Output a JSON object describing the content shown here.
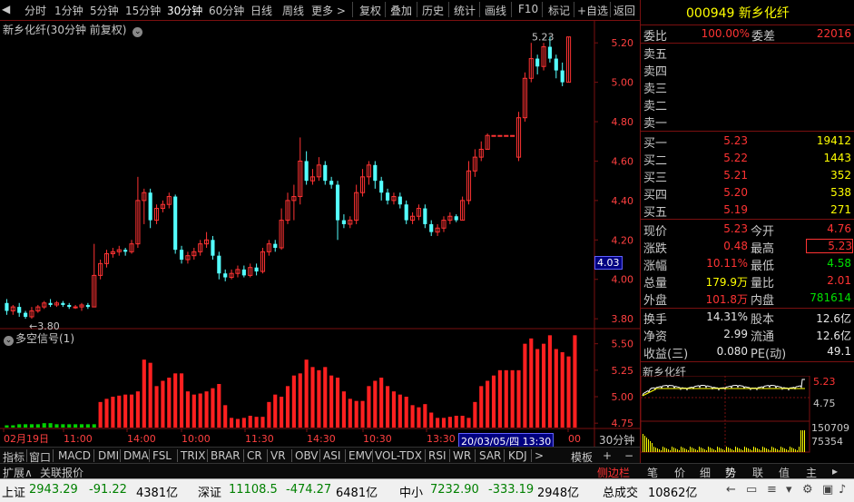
{
  "toolbar": {
    "period_tabs": [
      "分时",
      "1分钟",
      "5分钟",
      "15分钟",
      "30分钟",
      "60分钟",
      "日线",
      "周线",
      "更多 >"
    ],
    "active_period": "30分钟",
    "actions": [
      "复权",
      "叠加",
      "历史",
      "统计",
      "画线",
      "F10",
      "标记",
      "+自选",
      "返回"
    ]
  },
  "chart_title": "新乡化纤(30分钟 前复权)",
  "indicator_title": "多空信号(1)",
  "price_axis": [
    "5.20",
    "5.00",
    "4.80",
    "4.60",
    "4.40",
    "4.20",
    "4.00",
    "3.80"
  ],
  "indicator_axis": [
    "5.50",
    "5.25",
    "5.00",
    "4.75"
  ],
  "cursor_price": "4.03",
  "high_marker": "5.23",
  "low_marker": "3.80",
  "time_axis": [
    "02月19日",
    "11:00",
    "14:00",
    "10:00",
    "11:30",
    "14:30",
    "10:30",
    "13:30",
    "20/03/05/四 13:30",
    "00"
  ],
  "period_box": "30分钟",
  "chart_data": {
    "type": "candlestick",
    "x": [
      "02月19日",
      "11:00",
      "14:00",
      "10:00",
      "11:30",
      "14:30",
      "10:30",
      "13:30",
      "20/03/05/四 13:30"
    ],
    "ylim": [
      3.75,
      5.27
    ],
    "candles": [
      {
        "o": 3.88,
        "c": 3.84,
        "h": 3.9,
        "l": 3.82
      },
      {
        "o": 3.84,
        "c": 3.86,
        "h": 3.87,
        "l": 3.82
      },
      {
        "o": 3.86,
        "c": 3.83,
        "h": 3.88,
        "l": 3.81
      },
      {
        "o": 3.83,
        "c": 3.81,
        "h": 3.84,
        "l": 3.8
      },
      {
        "o": 3.81,
        "c": 3.84,
        "h": 3.86,
        "l": 3.8
      },
      {
        "o": 3.84,
        "c": 3.86,
        "h": 3.87,
        "l": 3.83
      },
      {
        "o": 3.86,
        "c": 3.88,
        "h": 3.89,
        "l": 3.85
      },
      {
        "o": 3.88,
        "c": 3.87,
        "h": 3.9,
        "l": 3.86
      },
      {
        "o": 3.87,
        "c": 3.88,
        "h": 3.89,
        "l": 3.86
      },
      {
        "o": 3.88,
        "c": 3.87,
        "h": 3.89,
        "l": 3.86
      },
      {
        "o": 3.87,
        "c": 3.86,
        "h": 3.88,
        "l": 3.85
      },
      {
        "o": 3.86,
        "c": 3.86,
        "h": 3.87,
        "l": 3.85
      },
      {
        "o": 3.86,
        "c": 3.87,
        "h": 3.88,
        "l": 3.84
      },
      {
        "o": 3.87,
        "c": 3.86,
        "h": 3.88,
        "l": 3.85
      },
      {
        "o": 3.86,
        "c": 4.02,
        "h": 4.18,
        "l": 3.86
      },
      {
        "o": 4.02,
        "c": 4.08,
        "h": 4.1,
        "l": 4.0
      },
      {
        "o": 4.08,
        "c": 4.13,
        "h": 4.15,
        "l": 4.06
      },
      {
        "o": 4.13,
        "c": 4.14,
        "h": 4.16,
        "l": 4.11
      },
      {
        "o": 4.14,
        "c": 4.15,
        "h": 4.17,
        "l": 4.12
      },
      {
        "o": 4.15,
        "c": 4.14,
        "h": 4.16,
        "l": 4.12
      },
      {
        "o": 4.14,
        "c": 4.18,
        "h": 4.2,
        "l": 4.13
      },
      {
        "o": 4.18,
        "c": 4.4,
        "h": 4.52,
        "l": 4.16
      },
      {
        "o": 4.4,
        "c": 4.44,
        "h": 4.46,
        "l": 4.28
      },
      {
        "o": 4.44,
        "c": 4.3,
        "h": 4.46,
        "l": 4.26
      },
      {
        "o": 4.3,
        "c": 4.36,
        "h": 4.38,
        "l": 4.28
      },
      {
        "o": 4.36,
        "c": 4.38,
        "h": 4.4,
        "l": 4.34
      },
      {
        "o": 4.38,
        "c": 4.42,
        "h": 4.44,
        "l": 4.36
      },
      {
        "o": 4.42,
        "c": 4.15,
        "h": 4.43,
        "l": 4.13
      },
      {
        "o": 4.15,
        "c": 4.1,
        "h": 4.17,
        "l": 4.08
      },
      {
        "o": 4.1,
        "c": 4.12,
        "h": 4.14,
        "l": 4.08
      },
      {
        "o": 4.12,
        "c": 4.14,
        "h": 4.16,
        "l": 4.1
      },
      {
        "o": 4.14,
        "c": 4.18,
        "h": 4.2,
        "l": 4.12
      },
      {
        "o": 4.18,
        "c": 4.2,
        "h": 4.24,
        "l": 4.16
      },
      {
        "o": 4.2,
        "c": 4.12,
        "h": 4.22,
        "l": 4.1
      },
      {
        "o": 4.12,
        "c": 4.03,
        "h": 4.14,
        "l": 4.0
      },
      {
        "o": 4.03,
        "c": 4.01,
        "h": 4.05,
        "l": 3.99
      },
      {
        "o": 4.01,
        "c": 4.03,
        "h": 4.05,
        "l": 4.0
      },
      {
        "o": 4.03,
        "c": 4.05,
        "h": 4.07,
        "l": 4.01
      },
      {
        "o": 4.05,
        "c": 4.02,
        "h": 4.07,
        "l": 4.01
      },
      {
        "o": 4.02,
        "c": 4.06,
        "h": 4.08,
        "l": 4.01
      },
      {
        "o": 4.06,
        "c": 4.04,
        "h": 4.08,
        "l": 4.02
      },
      {
        "o": 4.04,
        "c": 4.14,
        "h": 4.16,
        "l": 4.03
      },
      {
        "o": 4.14,
        "c": 4.18,
        "h": 4.2,
        "l": 4.12
      },
      {
        "o": 4.18,
        "c": 4.16,
        "h": 4.2,
        "l": 4.14
      },
      {
        "o": 4.16,
        "c": 4.3,
        "h": 4.36,
        "l": 4.15
      },
      {
        "o": 4.3,
        "c": 4.4,
        "h": 4.44,
        "l": 4.28
      },
      {
        "o": 4.4,
        "c": 4.42,
        "h": 4.48,
        "l": 4.3
      },
      {
        "o": 4.42,
        "c": 4.6,
        "h": 4.72,
        "l": 4.38
      },
      {
        "o": 4.6,
        "c": 4.5,
        "h": 4.65,
        "l": 4.48
      },
      {
        "o": 4.5,
        "c": 4.52,
        "h": 4.56,
        "l": 4.48
      },
      {
        "o": 4.52,
        "c": 4.58,
        "h": 4.62,
        "l": 4.5
      },
      {
        "o": 4.58,
        "c": 4.5,
        "h": 4.6,
        "l": 4.48
      },
      {
        "o": 4.5,
        "c": 4.48,
        "h": 4.52,
        "l": 4.46
      },
      {
        "o": 4.48,
        "c": 4.3,
        "h": 4.5,
        "l": 4.2
      },
      {
        "o": 4.3,
        "c": 4.28,
        "h": 4.33,
        "l": 4.26
      },
      {
        "o": 4.28,
        "c": 4.3,
        "h": 4.32,
        "l": 4.26
      },
      {
        "o": 4.3,
        "c": 4.44,
        "h": 4.48,
        "l": 4.28
      },
      {
        "o": 4.44,
        "c": 4.52,
        "h": 4.56,
        "l": 4.42
      },
      {
        "o": 4.52,
        "c": 4.58,
        "h": 4.6,
        "l": 4.48
      },
      {
        "o": 4.58,
        "c": 4.5,
        "h": 4.6,
        "l": 4.46
      },
      {
        "o": 4.5,
        "c": 4.44,
        "h": 4.52,
        "l": 4.4
      },
      {
        "o": 4.44,
        "c": 4.4,
        "h": 4.46,
        "l": 4.38
      },
      {
        "o": 4.4,
        "c": 4.42,
        "h": 4.44,
        "l": 4.38
      },
      {
        "o": 4.42,
        "c": 4.38,
        "h": 4.44,
        "l": 4.36
      },
      {
        "o": 4.38,
        "c": 4.3,
        "h": 4.4,
        "l": 4.28
      },
      {
        "o": 4.3,
        "c": 4.32,
        "h": 4.34,
        "l": 4.28
      },
      {
        "o": 4.32,
        "c": 4.36,
        "h": 4.38,
        "l": 4.3
      },
      {
        "o": 4.36,
        "c": 4.28,
        "h": 4.38,
        "l": 4.26
      },
      {
        "o": 4.28,
        "c": 4.24,
        "h": 4.3,
        "l": 4.22
      },
      {
        "o": 4.24,
        "c": 4.26,
        "h": 4.28,
        "l": 4.22
      },
      {
        "o": 4.26,
        "c": 4.3,
        "h": 4.32,
        "l": 4.24
      },
      {
        "o": 4.3,
        "c": 4.32,
        "h": 4.34,
        "l": 4.28
      },
      {
        "o": 4.32,
        "c": 4.3,
        "h": 4.33,
        "l": 4.29
      },
      {
        "o": 4.3,
        "c": 4.4,
        "h": 4.42,
        "l": 4.3
      },
      {
        "o": 4.4,
        "c": 4.55,
        "h": 4.6,
        "l": 4.38
      },
      {
        "o": 4.55,
        "c": 4.62,
        "h": 4.66,
        "l": 4.52
      },
      {
        "o": 4.62,
        "c": 4.66,
        "h": 4.7,
        "l": 4.6
      },
      {
        "o": 4.66,
        "c": 4.73,
        "h": 4.74,
        "l": 4.66
      },
      {
        "o": 4.73,
        "c": 4.73,
        "h": 4.73,
        "l": 4.73
      },
      {
        "o": 4.73,
        "c": 4.73,
        "h": 4.73,
        "l": 4.73
      },
      {
        "o": 4.73,
        "c": 4.73,
        "h": 4.73,
        "l": 4.73
      },
      {
        "o": 4.73,
        "c": 4.73,
        "h": 4.73,
        "l": 4.73
      },
      {
        "o": 4.62,
        "c": 4.82,
        "h": 4.85,
        "l": 4.6
      },
      {
        "o": 4.82,
        "c": 5.02,
        "h": 5.05,
        "l": 4.8
      },
      {
        "o": 5.02,
        "c": 5.12,
        "h": 5.2,
        "l": 5.0
      },
      {
        "o": 5.12,
        "c": 5.08,
        "h": 5.14,
        "l": 5.04
      },
      {
        "o": 5.08,
        "c": 5.18,
        "h": 5.2,
        "l": 5.06
      },
      {
        "o": 5.18,
        "c": 5.12,
        "h": 5.23,
        "l": 5.1
      },
      {
        "o": 5.12,
        "c": 5.06,
        "h": 5.14,
        "l": 5.02
      },
      {
        "o": 5.06,
        "c": 5.0,
        "h": 5.1,
        "l": 4.98
      },
      {
        "o": 5.0,
        "c": 5.23,
        "h": 5.23,
        "l": 5.0
      }
    ],
    "indicator": {
      "name": "多空信号(1)",
      "ylim": [
        4.7,
        5.6
      ],
      "values": [
        4.73,
        4.73,
        4.74,
        4.74,
        4.74,
        4.74,
        4.75,
        4.75,
        4.74,
        4.74,
        4.74,
        4.74,
        4.74,
        4.74,
        4.74,
        4.95,
        4.98,
        5.0,
        5.01,
        5.02,
        5.02,
        5.05,
        5.35,
        5.32,
        5.1,
        5.15,
        5.18,
        5.22,
        5.22,
        5.05,
        5.02,
        5.03,
        5.05,
        5.08,
        5.12,
        4.92,
        4.8,
        4.79,
        4.8,
        4.82,
        4.81,
        4.81,
        4.95,
        5.02,
        5.0,
        5.1,
        5.2,
        5.22,
        5.35,
        5.28,
        5.25,
        5.28,
        5.2,
        5.18,
        5.05,
        4.98,
        4.96,
        4.96,
        5.1,
        5.15,
        5.18,
        5.1,
        5.05,
        5.02,
        5.0,
        4.92,
        4.9,
        4.93,
        4.85,
        4.8,
        4.8,
        4.81,
        4.82,
        4.82,
        4.8,
        4.95,
        5.1,
        5.15,
        5.2,
        5.25,
        5.25,
        5.25,
        5.25,
        5.5,
        5.55,
        5.45,
        5.5,
        5.58,
        5.45,
        5.42,
        5.38,
        5.58
      ]
    }
  },
  "quote": {
    "code": "000949",
    "name": "新乡化纤",
    "webi_label": "委比",
    "webi_value": "100.00%",
    "weicha_label": "委差",
    "weicha_value": "22016",
    "sell_labels": [
      "卖五",
      "卖四",
      "卖三",
      "卖二",
      "卖一"
    ],
    "buy": [
      {
        "label": "买一",
        "price": "5.23",
        "vol": "19412"
      },
      {
        "label": "买二",
        "price": "5.22",
        "vol": "1443"
      },
      {
        "label": "买三",
        "price": "5.21",
        "vol": "352"
      },
      {
        "label": "买四",
        "price": "5.20",
        "vol": "538"
      },
      {
        "label": "买五",
        "price": "5.19",
        "vol": "271"
      }
    ],
    "stats": [
      {
        "l1": "现价",
        "v1": "5.23",
        "c1": "red",
        "l2": "今开",
        "v2": "4.76",
        "c2": "red"
      },
      {
        "l1": "涨跌",
        "v1": "0.48",
        "c1": "red",
        "l2": "最高",
        "v2": "5.23",
        "c2": "red"
      },
      {
        "l1": "涨幅",
        "v1": "10.11%",
        "c1": "red",
        "l2": "最低",
        "v2": "4.58",
        "c2": "green"
      },
      {
        "l1": "总量",
        "v1": "179.9万",
        "c1": "yellow",
        "l2": "量比",
        "v2": "2.01",
        "c2": "red"
      },
      {
        "l1": "外盘",
        "v1": "101.8万",
        "c1": "red",
        "l2": "内盘",
        "v2": "781614",
        "c2": "green"
      }
    ],
    "stats2": [
      {
        "l1": "换手",
        "v1": "14.31%",
        "l2": "股本",
        "v2": "12.6亿"
      },
      {
        "l1": "净资",
        "v1": "2.99",
        "l2": "流通",
        "v2": "12.6亿"
      },
      {
        "l1": "收益(三)",
        "v1": "0.080",
        "l2": "PE(动)",
        "v2": "49.1"
      }
    ]
  },
  "mini": {
    "name": "新乡化纤",
    "price_hi": "5.23",
    "price_lo": "4.75",
    "vol_hi": "150709",
    "vol_lo": "75354"
  },
  "bottom_tabs": [
    "指标",
    "窗口",
    "MACD",
    "DMI",
    "DMA",
    "FSL",
    "TRIX",
    "BRAR",
    "CR",
    "VR",
    "OBV",
    "ASI",
    "EMV",
    "VOL-TDX",
    "RSI",
    "WR",
    "SAR",
    "KDJ",
    ">"
  ],
  "bottom_right": "模板",
  "row2": [
    "扩展∧",
    "关联报价"
  ],
  "side_toggle": "侧边栏",
  "nav_tabs": [
    "笔",
    "价",
    "细",
    "势",
    "联",
    "值",
    "主"
  ],
  "status": {
    "items": [
      {
        "label": "上证",
        "value": "2943.29",
        "change": "-91.22",
        "amount": "4381亿"
      },
      {
        "label": "深证",
        "value": "11108.5",
        "change": "-474.27",
        "amount": "6481亿"
      },
      {
        "label": "中小",
        "value": "7232.90",
        "change": "-333.19",
        "amount": "2948亿"
      }
    ],
    "total_label": "总成交",
    "total_value": "10862亿"
  },
  "colors": {
    "up": "#ff3333",
    "down": "#54ffff",
    "grid": "#7a1010",
    "bg": "#000000"
  }
}
